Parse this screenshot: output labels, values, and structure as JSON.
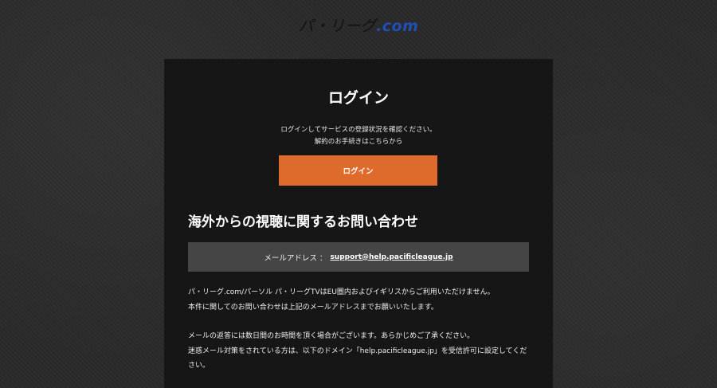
{
  "logo": {
    "main": "パ・リーグ",
    "domain": ".com"
  },
  "login": {
    "title": "ログイン",
    "desc_line1": "ログインしてサービスの登録状況を確認ください。",
    "desc_line2": "解約のお手続きはこちらから",
    "button_label": "ログイン"
  },
  "inquiry": {
    "title": "海外からの視聴に関するお問い合わせ",
    "mail_label": "メールアドレス ：",
    "mail_address": "support@help.pacificleague.jp",
    "para1_line1": "パ・リーグ.com/パーソル パ・リーグTVはEU圏内およびイギリスからご利用いただけません。",
    "para1_line2": "本件に関してのお問い合わせは上記のメールアドレスまでお願いいたします。",
    "para2_line1": "メールの返答には数日間のお時間を頂く場合がございます。あらかじめご了承ください。",
    "para2_line2": "迷惑メール対策をされている方は、以下のドメイン「help.pacificleague.jp」を受信許可に設定してください。"
  },
  "colors": {
    "accent": "#de6a2b",
    "brand_blue": "#1f4fb8",
    "card_bg": "#161616",
    "mailbox_bg": "#454545",
    "page_bg": "#2a2a2a"
  }
}
